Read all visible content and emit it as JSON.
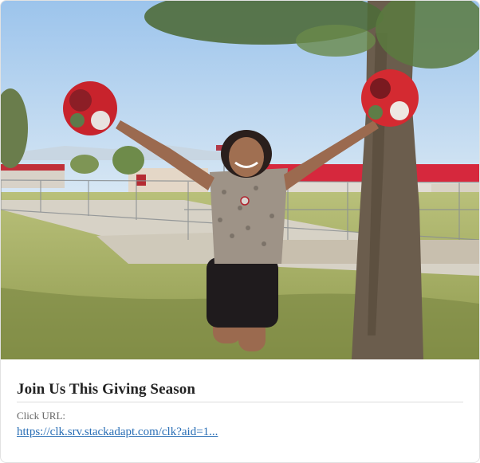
{
  "card": {
    "image": {
      "description_icon": "photo-image",
      "colors": {
        "sky": "#a9cdef",
        "grass": "#a7b062",
        "bark": "#6b5d4d",
        "pompom": "#c8232c"
      }
    },
    "title": "Join Us This Giving Season",
    "url_label": "Click URL:",
    "url": "https://clk.srv.stackadapt.com/clk?aid=1..."
  }
}
